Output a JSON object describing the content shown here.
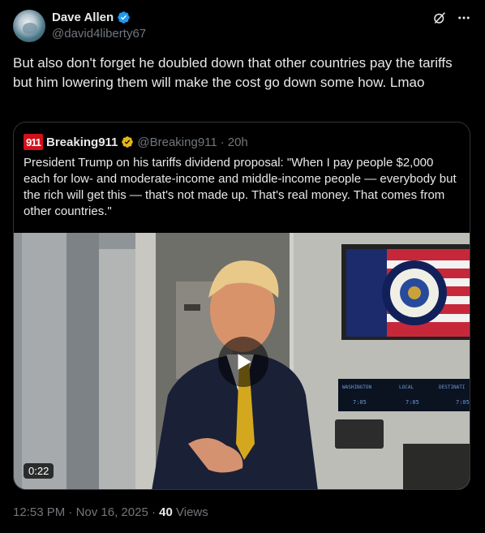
{
  "author": {
    "name": "Dave Allen",
    "handle": "@david4liberty67"
  },
  "tweet": {
    "text": "But also don't forget he doubled down that other countries pay the tariffs but him lowering them will make the cost go down some how. Lmao"
  },
  "quote": {
    "logo_text": "911",
    "name": "Breaking911",
    "handle": "@Breaking911",
    "separator": "·",
    "time": "20h",
    "text": "President Trump on his tariffs dividend proposal: \"When I pay people $2,000 each for low- and moderate-income and middle-income people — everybody but the rich will get this — that's not made up. That's real money. That comes from other countries.\"",
    "video": {
      "duration": "0:22",
      "screen_labels": [
        "WASHINGTON",
        "LOCAL",
        "DESTINATI"
      ],
      "screen_times": [
        "7:05",
        "7:05",
        "7:05"
      ]
    }
  },
  "meta": {
    "time": "12:53 PM",
    "separator1": "·",
    "date": "Nov 16, 2025",
    "separator2": "·",
    "views_count": "40",
    "views_label": "Views"
  },
  "colors": {
    "background": "#000000",
    "text": "#e7e9ea",
    "muted": "#71767b",
    "verified_blue": "#1d9bf0",
    "verified_gold": "#e2b719",
    "border": "#2f3336"
  },
  "icons": [
    "verified-badge-icon",
    "grok-icon",
    "more-options-icon",
    "play-icon"
  ]
}
